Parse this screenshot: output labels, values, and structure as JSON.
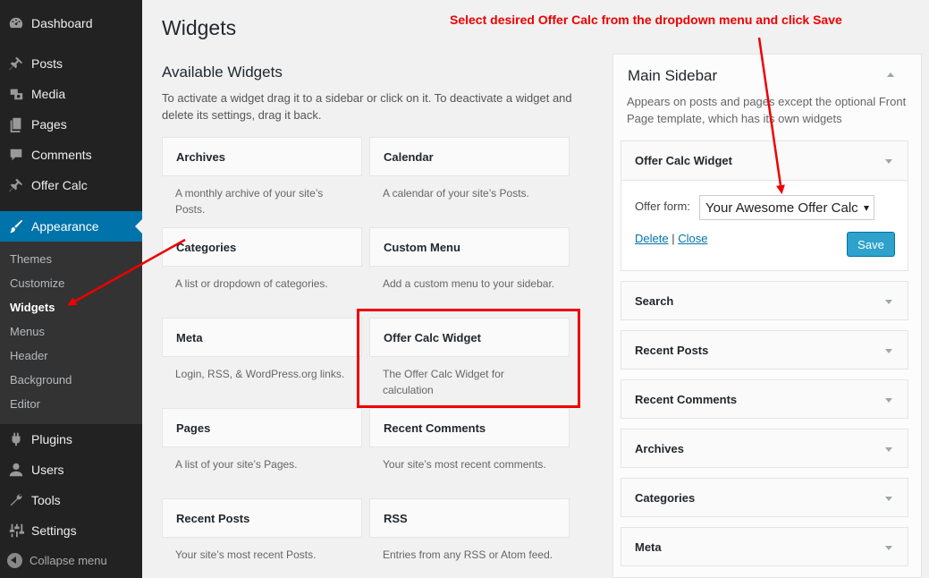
{
  "menu": {
    "dashboard": "Dashboard",
    "posts": "Posts",
    "media": "Media",
    "pages": "Pages",
    "comments": "Comments",
    "offer_calc": "Offer Calc",
    "appearance": "Appearance",
    "submenu": {
      "themes": "Themes",
      "customize": "Customize",
      "widgets": "Widgets",
      "menus": "Menus",
      "header": "Header",
      "background": "Background",
      "editor": "Editor"
    },
    "plugins": "Plugins",
    "users": "Users",
    "tools": "Tools",
    "settings": "Settings",
    "collapse": "Collapse menu"
  },
  "page": {
    "title": "Widgets",
    "available_title": "Available Widgets",
    "available_desc": "To activate a widget drag it to a sidebar or click on it. To deactivate a widget and delete its settings, drag it back."
  },
  "widgets": [
    {
      "title": "Archives",
      "desc": "A monthly archive of your site’s Posts."
    },
    {
      "title": "Calendar",
      "desc": "A calendar of your site’s Posts."
    },
    {
      "title": "Categories",
      "desc": "A list or dropdown of categories."
    },
    {
      "title": "Custom Menu",
      "desc": "Add a custom menu to your sidebar."
    },
    {
      "title": "Meta",
      "desc": "Login, RSS, & WordPress.org links."
    },
    {
      "title": "Offer Calc Widget",
      "desc": "The Offer Calc Widget for calculation"
    },
    {
      "title": "Pages",
      "desc": "A list of your site’s Pages."
    },
    {
      "title": "Recent Comments",
      "desc": "Your site’s most recent comments."
    },
    {
      "title": "Recent Posts",
      "desc": "Your site’s most recent Posts."
    },
    {
      "title": "RSS",
      "desc": "Entries from any RSS or Atom feed."
    }
  ],
  "sidebar": {
    "title": "Main Sidebar",
    "desc": "Appears on posts and pages except the optional Front Page template, which has its own widgets",
    "expanded": {
      "title": "Offer Calc Widget",
      "offer_label": "Offer form:",
      "offer_value": "Your Awesome Offer Calc",
      "delete": "Delete",
      "separator": "|",
      "close": "Close",
      "save": "Save"
    },
    "widgets": [
      "Search",
      "Recent Posts",
      "Recent Comments",
      "Archives",
      "Categories",
      "Meta"
    ]
  },
  "annotation": {
    "instruction": "Select desired Offer Calc from the dropdown menu and  click Save",
    "color": "#e00000"
  },
  "colors": {
    "admin_bar": "#222222",
    "accent": "#0073aa",
    "save_button": "#2ea2cc"
  }
}
